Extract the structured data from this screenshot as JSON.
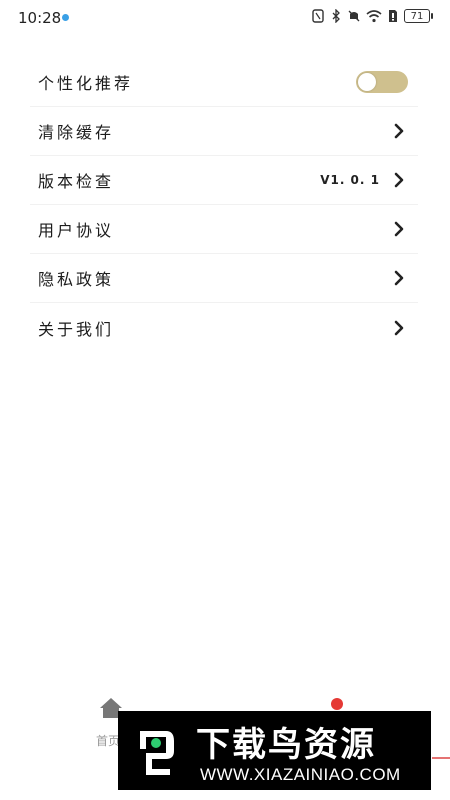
{
  "status_bar": {
    "time": "10:28",
    "battery": "71",
    "icons": [
      "nfc-icon",
      "bluetooth-icon",
      "mute-icon",
      "wifi-icon",
      "sim-icon",
      "battery-icon"
    ]
  },
  "settings": {
    "personalized": {
      "label": "个性化推荐",
      "enabled": false
    },
    "clear_cache": {
      "label": "清除缓存"
    },
    "version_check": {
      "label": "版本检查",
      "value": "V1. 0. 1"
    },
    "user_agreement": {
      "label": "用户协议"
    },
    "privacy_policy": {
      "label": "隐私政策"
    },
    "about_us": {
      "label": "关于我们"
    }
  },
  "bottom_nav": {
    "home_label": "首页"
  },
  "watermark": {
    "title": "下载鸟资源",
    "url": "WWW.XIAZAINIAO.COM"
  },
  "colors": {
    "toggle_track": "#cfc08e",
    "accent_red": "#e53935",
    "status_dot": "#3aa0e6"
  }
}
